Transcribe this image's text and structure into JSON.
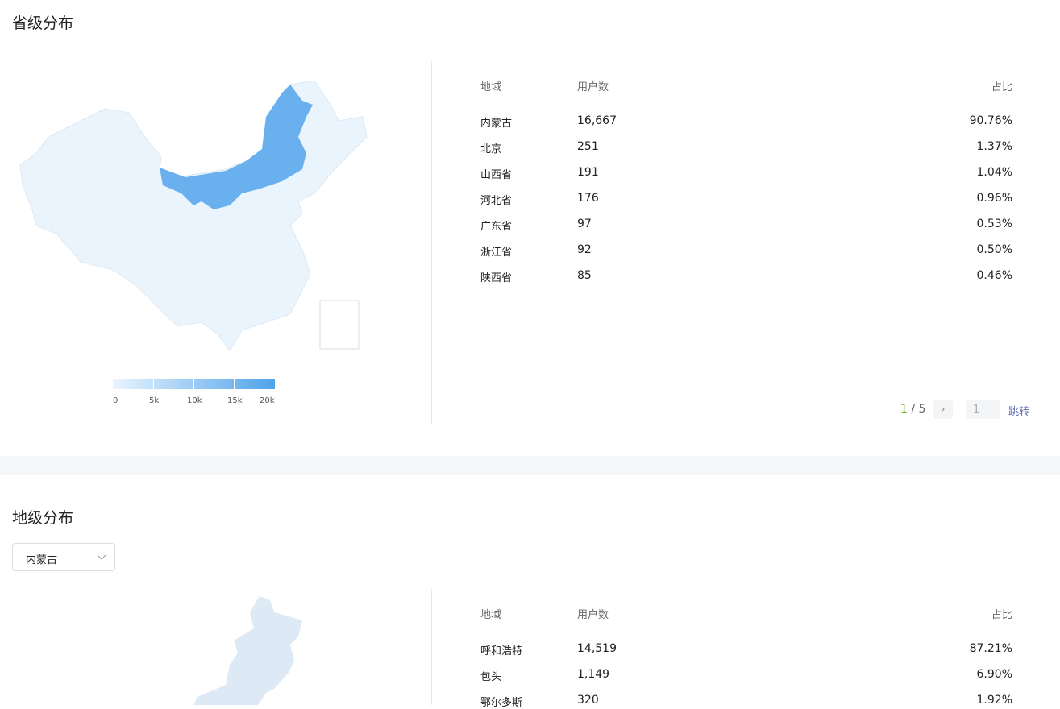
{
  "province": {
    "title": "省级分布",
    "headers": {
      "region": "地域",
      "users": "用户数",
      "ratio": "占比"
    },
    "rows": [
      {
        "region": "内蒙古",
        "users": "16,667",
        "ratio": "90.76%"
      },
      {
        "region": "北京",
        "users": "251",
        "ratio": "1.37%"
      },
      {
        "region": "山西省",
        "users": "191",
        "ratio": "1.04%"
      },
      {
        "region": "河北省",
        "users": "176",
        "ratio": "0.96%"
      },
      {
        "region": "广东省",
        "users": "97",
        "ratio": "0.53%"
      },
      {
        "region": "浙江省",
        "users": "92",
        "ratio": "0.50%"
      },
      {
        "region": "陕西省",
        "users": "85",
        "ratio": "0.46%"
      }
    ],
    "legend": [
      "0",
      "5k",
      "10k",
      "15k",
      "20k"
    ],
    "pagination": {
      "current": "1",
      "total": "5",
      "sep": " / ",
      "jump_value": "1",
      "jump_label": "跳转",
      "next_icon": "chevron-right"
    },
    "colors": {
      "highlight": "#6ab0ee",
      "base": "#eaf4fd"
    }
  },
  "city": {
    "title": "地级分布",
    "select_value": "内蒙古",
    "headers": {
      "region": "地域",
      "users": "用户数",
      "ratio": "占比"
    },
    "rows": [
      {
        "region": "呼和浩特",
        "users": "14,519",
        "ratio": "87.21%"
      },
      {
        "region": "包头",
        "users": "1,149",
        "ratio": "6.90%"
      },
      {
        "region": "鄂尔多斯",
        "users": "320",
        "ratio": "1.92%"
      }
    ]
  }
}
